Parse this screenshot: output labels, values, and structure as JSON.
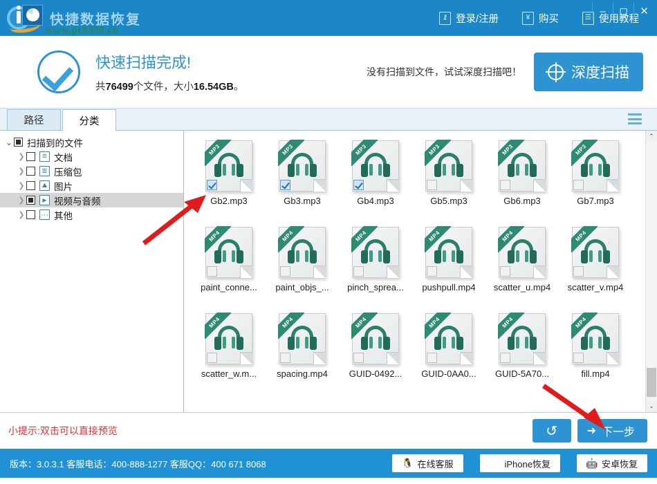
{
  "window": {
    "minimize": "–",
    "maximize": "◻",
    "close": "✕"
  },
  "brand": {
    "name": "快捷数据恢复",
    "watermark": "www.pc0359.cn",
    "accent": "#1b87c9"
  },
  "topnav": [
    {
      "label": "登录/注册",
      "icon": "key-icon",
      "glyph": "⚷"
    },
    {
      "label": "购买",
      "icon": "yen-icon",
      "glyph": "¥"
    },
    {
      "label": "使用教程",
      "icon": "book-icon",
      "glyph": "☰"
    }
  ],
  "banner": {
    "status_icon": "check-circle-icon",
    "title": "快速扫描完成!",
    "summary_prefix": "共",
    "file_count": "76499",
    "summary_middle": "个文件，大小",
    "total_size": "16.54GB",
    "summary_suffix": "。",
    "hint": "没有扫描到文件，试试深度扫描吧！",
    "deep_scan_label": "深度扫描",
    "deep_scan_icon": "target-icon"
  },
  "tabs": [
    {
      "label": "路径",
      "active": false
    },
    {
      "label": "分类",
      "active": true
    }
  ],
  "menu_icon": "hamburger-icon",
  "tree": {
    "root": {
      "label": "扫描到的文件",
      "checkstate": "partial",
      "expanded": true
    },
    "children": [
      {
        "label": "文档",
        "icon": "document-icon",
        "checked": false,
        "selected": false
      },
      {
        "label": "压缩包",
        "icon": "archive-icon",
        "checked": false,
        "selected": false
      },
      {
        "label": "图片",
        "icon": "image-icon",
        "checked": false,
        "selected": false
      },
      {
        "label": "视频与音频",
        "icon": "video-icon",
        "checked": "partial",
        "selected": true
      },
      {
        "label": "其他",
        "icon": "other-icon",
        "checked": false,
        "selected": false
      }
    ]
  },
  "files": [
    {
      "name": "Gb2.mp3",
      "type": "MP3",
      "checked": true
    },
    {
      "name": "Gb3.mp3",
      "type": "MP3",
      "checked": true
    },
    {
      "name": "Gb4.mp3",
      "type": "MP3",
      "checked": true
    },
    {
      "name": "Gb5.mp3",
      "type": "MP3",
      "checked": false
    },
    {
      "name": "Gb6.mp3",
      "type": "MP3",
      "checked": false
    },
    {
      "name": "Gb7.mp3",
      "type": "MP3",
      "checked": false
    },
    {
      "name": "paint_conne...",
      "type": "MP4",
      "checked": false
    },
    {
      "name": "paint_objs_...",
      "type": "MP4",
      "checked": false
    },
    {
      "name": "pinch_sprea...",
      "type": "MP4",
      "checked": false
    },
    {
      "name": "pushpull.mp4",
      "type": "MP4",
      "checked": false
    },
    {
      "name": "scatter_u.mp4",
      "type": "MP4",
      "checked": false
    },
    {
      "name": "scatter_v.mp4",
      "type": "MP4",
      "checked": false
    },
    {
      "name": "scatter_w.m...",
      "type": "MP4",
      "checked": false
    },
    {
      "name": "spacing.mp4",
      "type": "MP4",
      "checked": false
    },
    {
      "name": "GUID-0492...",
      "type": "MP4",
      "checked": false
    },
    {
      "name": "GUID-0AA0...",
      "type": "MP4",
      "checked": false
    },
    {
      "name": "GUID-5A70...",
      "type": "MP4",
      "checked": false
    },
    {
      "name": "fill.mp4",
      "type": "MP4",
      "checked": false
    }
  ],
  "scrollbar": {
    "up": "⌃",
    "down": "⌄"
  },
  "actionbar": {
    "tip": "小提示:双击可以直接预览",
    "back_label": "↺",
    "next_label": "下一步",
    "next_icon": "arrow-right-icon"
  },
  "footer": {
    "info": "版本：3.0.3.1 客服电话：400-888-1277   客服QQ：400 671 8068",
    "buttons": [
      {
        "label": "在线客服",
        "icon": "qq-penguin-icon",
        "glyph": "🐧"
      },
      {
        "label": "iPhone恢复",
        "icon": "apple-icon",
        "glyph": ""
      },
      {
        "label": "安卓恢复",
        "icon": "android-icon",
        "glyph": "🤖"
      }
    ]
  }
}
